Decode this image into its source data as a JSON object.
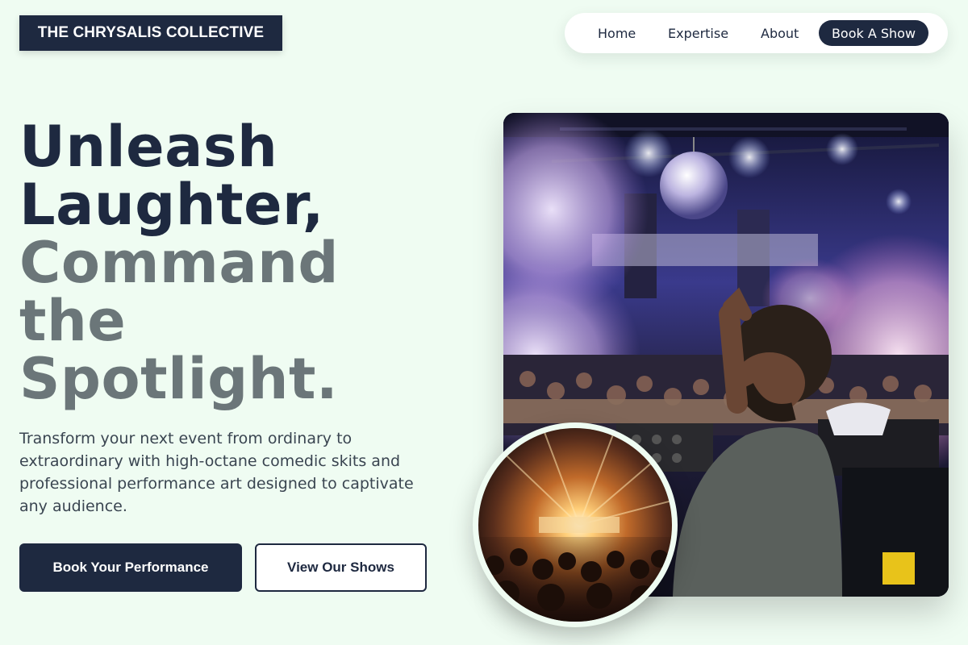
{
  "brand": {
    "logo_text": "THE CHRYSALIS COLLECTIVE"
  },
  "nav": {
    "items": [
      {
        "label": "Home"
      },
      {
        "label": "Expertise"
      },
      {
        "label": "About"
      }
    ],
    "cta_label": "Book A Show"
  },
  "hero": {
    "headline_dark": [
      "Unleash",
      "Laughter,"
    ],
    "headline_gray": [
      "Command",
      "the",
      "Spotlight."
    ],
    "description": "Transform your next event from ordinary to extraordinary with high-octane comedic skits and professional performance art designed to captivate any audience.",
    "primary_button": "Book Your Performance",
    "secondary_button": "View Our Shows"
  },
  "images": {
    "main": {
      "subject": "dj-club-crowd-photo"
    },
    "inset": {
      "subject": "concert-stage-crowd-photo"
    }
  },
  "colors": {
    "background": "#effcf2",
    "primary_dark": "#1e2940",
    "headline_gray": "#6b7679",
    "white": "#ffffff"
  }
}
